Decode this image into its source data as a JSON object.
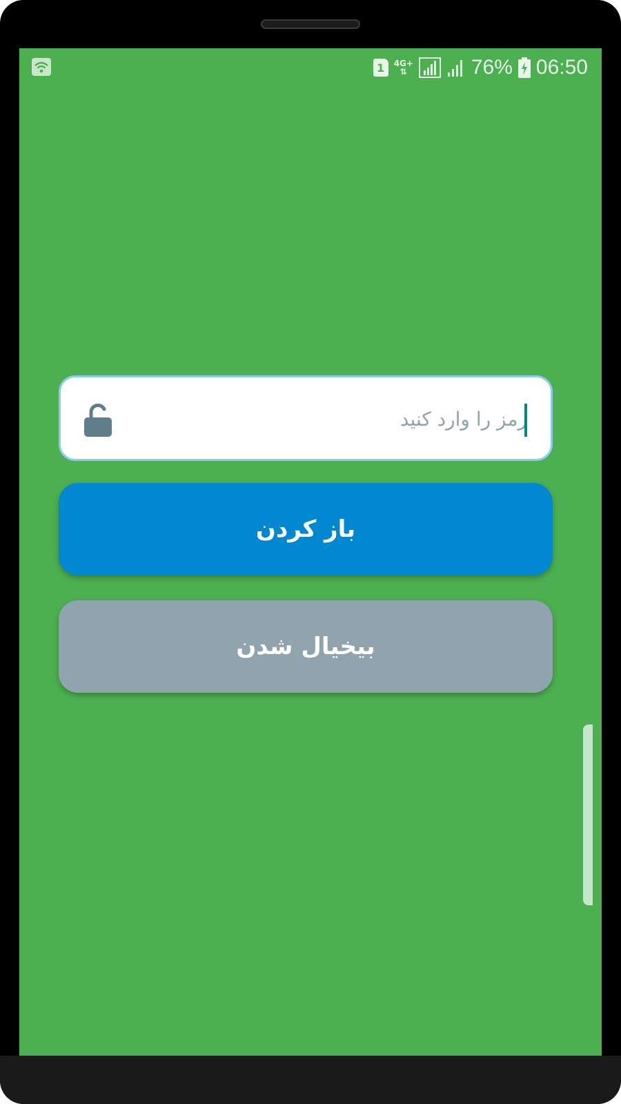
{
  "status_bar": {
    "sim_slot": "1",
    "network_type": "4G+",
    "battery_percent": "76%",
    "time": "06:50"
  },
  "password_field": {
    "placeholder": "رمز را وارد کنید",
    "value": ""
  },
  "buttons": {
    "open_label": "باز کردن",
    "cancel_label": "بیخیال شدن"
  },
  "colors": {
    "screen_background": "#4caf50",
    "open_button": "#0288d1",
    "cancel_button": "#90a4ae",
    "field_border": "#90caf9",
    "lock_icon": "#607d8b"
  },
  "icons": {
    "status_wifi": "wifi-icon",
    "status_signal": "signal-icon",
    "status_battery": "battery-charging-icon",
    "field_lock": "unlock-icon"
  }
}
